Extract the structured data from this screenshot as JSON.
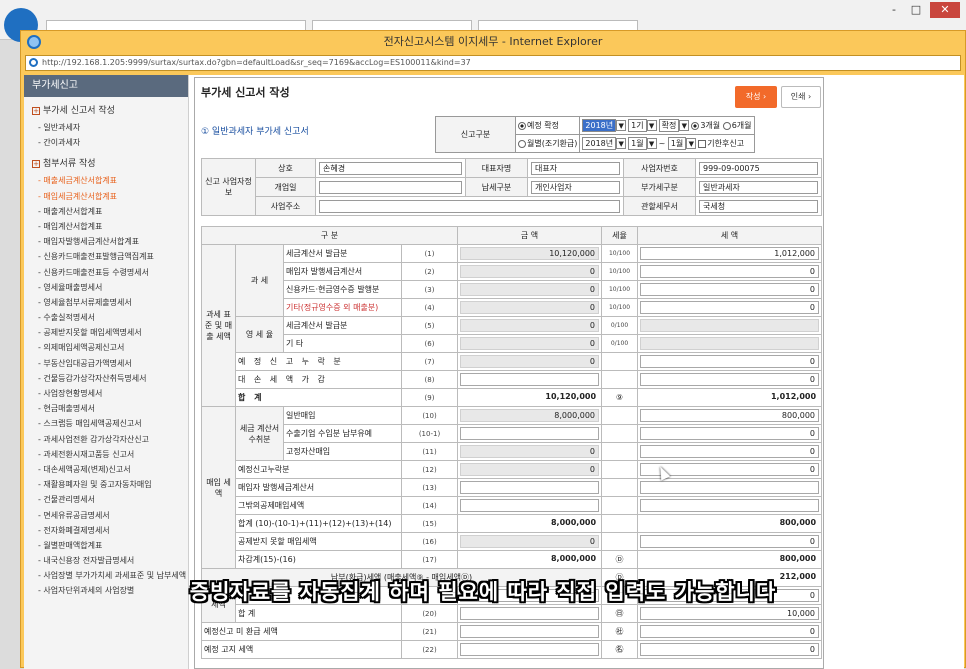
{
  "window": {
    "title": "전자신고시스템 이지세무 - Internet Explorer",
    "url": "http://192.168.1.205:9999/surtax/surtax.do?gbn=defaultLoad&sr_seq=7169&accLog=ES100011&kind=37",
    "controls": [
      "-",
      "□",
      "✕"
    ]
  },
  "sidebar": {
    "header": "부가세신고",
    "section1": "부가세 신고서 작성",
    "section1_items": [
      "일반과세자",
      "간이과세자"
    ],
    "section2": "첨부서류 작성",
    "items": [
      {
        "label": "매출세금계산서합계표",
        "active": true
      },
      {
        "label": "매입세금계산서합계표",
        "active": true
      },
      {
        "label": "매출계산서합계표",
        "active": false
      },
      {
        "label": "매입계산서합계표",
        "active": false
      },
      {
        "label": "매입자발행세금계산서합계표",
        "active": false
      },
      {
        "label": "신용카드매출전표발행금액집계표",
        "active": false
      },
      {
        "label": "신용카드매출전표등 수령명세서",
        "active": false
      },
      {
        "label": "영세율매출명세서",
        "active": false
      },
      {
        "label": "영세율첨부서류제출명세서",
        "active": false
      },
      {
        "label": "수출실적명세서",
        "active": false
      },
      {
        "label": "공제받지못할 매입세액명세서",
        "active": false
      },
      {
        "label": "의제매입세액공제신고서",
        "active": false
      },
      {
        "label": "부동산임대공급가액명세서",
        "active": false
      },
      {
        "label": "건물등감가상각자산취득명세서",
        "active": false
      },
      {
        "label": "사업장현황명세서",
        "active": false
      },
      {
        "label": "현금매출명세서",
        "active": false
      },
      {
        "label": "스크랩등 매입세액공제신고서",
        "active": false
      },
      {
        "label": "과세사업전환 감가상각자산신고",
        "active": false
      },
      {
        "label": "과세전환시재고품등 신고서",
        "active": false
      },
      {
        "label": "대손세액공제(변제)신고서",
        "active": false
      },
      {
        "label": "재활용폐자원 및 중고자동차매입",
        "active": false
      },
      {
        "label": "건물관리명세서",
        "active": false
      },
      {
        "label": "면세유류공급명세서",
        "active": false
      },
      {
        "label": "전자화폐결제명세서",
        "active": false
      },
      {
        "label": "월별판매액합계표",
        "active": false
      },
      {
        "label": "내국신용장 전자발급명세서",
        "active": false
      },
      {
        "label": "사업장별 부가가치세 과세표준 및 납부세액",
        "active": false
      },
      {
        "label": "사업자단위과세의 사업장별",
        "active": false
      }
    ]
  },
  "main": {
    "title": "부가세 신고서 작성",
    "btn_write": "작성 ›",
    "btn_print": "인쇄 ›",
    "subtitle": "① 일반과세자 부가세 신고서",
    "classification": {
      "label": "신고구분",
      "radio1": "예정 확정",
      "radio2": "월별(조기환급)",
      "year1": "2018년",
      "year2": "2018년",
      "period": "1기",
      "kind": "확정",
      "month_from": "1월",
      "tilde": "~",
      "month_to": "1월",
      "opt3": "3개월",
      "opt6": "6개월",
      "late": "기한후신고"
    },
    "biz": {
      "group_label": "신고 사업자정보",
      "trade_name_label": "상호",
      "trade_name": "손혜경",
      "rep_label": "대표자명",
      "rep": "대표자",
      "bizno_label": "사업자번호",
      "bizno": "999-09-00075",
      "open_label": "개업일",
      "open": "",
      "payer_label": "납세구분",
      "payer": "개인사업자",
      "vat_type_label": "부가세구분",
      "vat_type": "일반과세자",
      "addr_label": "사업주소",
      "addr": "",
      "office_label": "관할세무서",
      "office": "국세청"
    },
    "grid_header": {
      "category": "구 분",
      "amount": "금 액",
      "rate": "세율",
      "tax": "세 액"
    },
    "sales": {
      "group": "과세 표준 및 매출 세액",
      "taxable": "과 세",
      "zero": "영 세 율",
      "rows": [
        {
          "label": "세금계산서 발급분",
          "code": "(1)",
          "amount": "10,120,000",
          "rate": "10/100",
          "tax": "1,012,000"
        },
        {
          "label": "매입자 발행세금계산서",
          "code": "(2)",
          "amount": "0",
          "rate": "10/100",
          "tax": "0"
        },
        {
          "label": "신용카드·현금영수증 발행분",
          "code": "(3)",
          "amount": "0",
          "rate": "10/100",
          "tax": "0"
        },
        {
          "label": "기타(정규영수증 외 매출분)",
          "code": "(4)",
          "amount": "0",
          "rate": "10/100",
          "tax": "0"
        },
        {
          "label": "세금계산서 발급분",
          "code": "(5)",
          "amount": "0",
          "rate": "0/100",
          "tax": ""
        },
        {
          "label": "기 타",
          "code": "(6)",
          "amount": "0",
          "rate": "0/100",
          "tax": ""
        },
        {
          "label": "예 정 신 고 누 락 분",
          "code": "(7)",
          "amount": "0",
          "rate": "",
          "tax": "0"
        },
        {
          "label": "대 손 세 액 가 감",
          "code": "(8)",
          "amount": "",
          "rate": "",
          "tax": "0"
        },
        {
          "label": "합 계",
          "code": "(9)",
          "amount": "10,120,000",
          "rate": "⑨",
          "tax": "1,012,000"
        }
      ]
    },
    "purchase": {
      "group": "매입 세액",
      "tax_inv": "세금 계산서 수취분",
      "rows": [
        {
          "label": "일반매입",
          "code": "(10)",
          "amount": "8,000,000",
          "rate": "",
          "tax": "800,000"
        },
        {
          "label": "수출기업 수입분 납부유예",
          "code": "(10-1)",
          "amount": "",
          "rate": "",
          "tax": "0"
        },
        {
          "label": "고정자산매입",
          "code": "(11)",
          "amount": "0",
          "rate": "",
          "tax": "0"
        },
        {
          "label": "예정신고누락분",
          "code": "(12)",
          "amount": "0",
          "rate": "",
          "tax": "0"
        },
        {
          "label": "매입자 발행세금계산서",
          "code": "(13)",
          "amount": "",
          "rate": "",
          "tax": ""
        },
        {
          "label": "그밖의공제매입세액",
          "code": "(14)",
          "amount": "",
          "rate": "",
          "tax": ""
        },
        {
          "label": "합계 (10)-(10-1)+(11)+(12)+(13)+(14)",
          "code": "(15)",
          "amount": "8,000,000",
          "rate": "",
          "tax": "800,000"
        },
        {
          "label": "공제받지 못할 매입세액",
          "code": "(16)",
          "amount": "0",
          "rate": "",
          "tax": "0"
        },
        {
          "label": "차감계(15)-(16)",
          "code": "(17)",
          "amount": "8,000,000",
          "rate": "Ⓓ",
          "tax": "800,000"
        }
      ]
    },
    "payable": {
      "label": "납부(환급)세액 (매출세액⑨ - 매입세액Ⓓ)",
      "sym": "Ⓓ",
      "tax": "212,000"
    },
    "lower": {
      "group": "세액",
      "rows": [
        {
          "label": "",
          "code": "",
          "amount": "",
          "sym": "",
          "tax": "0"
        },
        {
          "label": "합 계",
          "code": "(20)",
          "amount": "",
          "sym": "㊐",
          "tax": "10,000"
        },
        {
          "label": "예정신고 미 환급 세액",
          "code": "(21)",
          "amount": "",
          "sym": "㊓",
          "tax": "0"
        },
        {
          "label": "예정 고지 세액",
          "code": "(22)",
          "amount": "",
          "sym": "㊔",
          "tax": "0"
        }
      ]
    }
  },
  "caption": "증빙자료를 자동집계 하며 필요에 따라 직접 입력도 가능합니다"
}
